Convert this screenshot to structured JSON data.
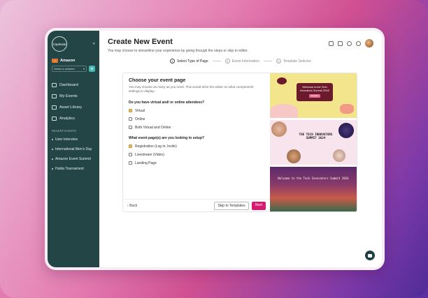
{
  "sidebar": {
    "logo": "Captivate",
    "org": "Amazon",
    "select_placeholder": "Select a scheme",
    "nav": [
      "Dashboard",
      "My Events",
      "Asset Library",
      "Analytics"
    ],
    "recent_title": "RECENT EVENTS",
    "recent": [
      "User Interview",
      "International Men's Day",
      "Amazon Event Summit",
      "Hulda Tournament"
    ]
  },
  "header": {
    "title": "Create New Event",
    "subtitle": "You may choose to streamline your experience by going through the steps or skip to editor."
  },
  "steps": [
    {
      "n": "1",
      "label": "Select Type of Page"
    },
    {
      "n": "2",
      "label": "Event Information"
    },
    {
      "n": "3",
      "label": "Template Selector"
    }
  ],
  "form": {
    "title": "Choose your event page",
    "desc": "You may choose as many as you need. This would drive the editor on what components settings to display.",
    "q1": "Do you have virtual and/ or online attendees?",
    "q1_opts": [
      "Virtual",
      "Online",
      "Both Virtual and Online"
    ],
    "q2": "What event page(s) are you looking to setup?",
    "q2_opts": [
      "Registration (Log in, Invite)",
      "Livestream (Video)",
      "Landing Page"
    ],
    "back": "Back",
    "skip": "Skip to Templates",
    "next": "Next"
  },
  "templates": {
    "t1_title": "Welcome to the Tech Innovators Summit 2024!",
    "t1_btn": "Register",
    "t2_title": "THE TECH INNOVATORS SUMMIT 2024",
    "t3_title": "Welcome to the Tech Innovators Summit 2024"
  },
  "colors": {
    "sidebar": "#234546",
    "accent": "#d81b6e",
    "checkbox": "#e8b860"
  }
}
